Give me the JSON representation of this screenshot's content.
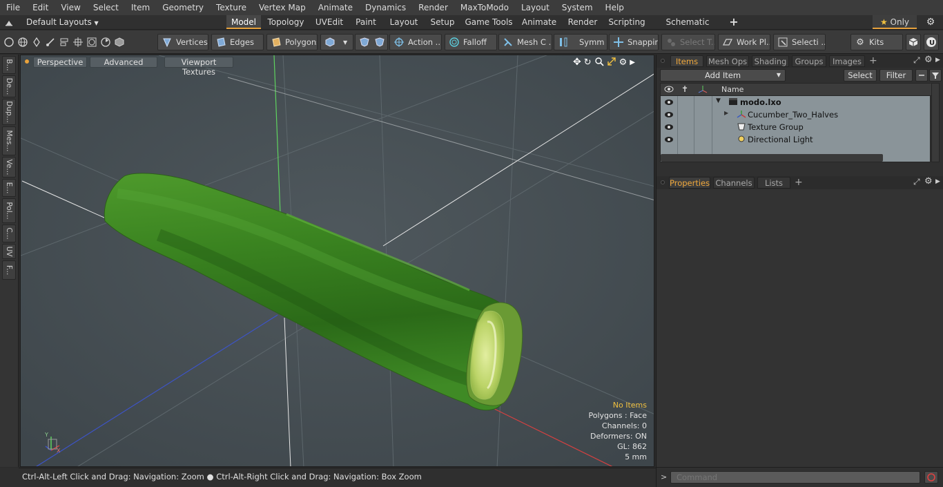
{
  "menu": [
    "File",
    "Edit",
    "View",
    "Select",
    "Item",
    "Geometry",
    "Texture",
    "Vertex Map",
    "Animate",
    "Dynamics",
    "Render",
    "MaxToModo",
    "Layout",
    "System",
    "Help"
  ],
  "layout_bar": {
    "layout_selector": "Default Layouts",
    "tabs": [
      "Model",
      "Topology",
      "UVEdit",
      "Paint",
      "Layout",
      "Setup",
      "Game Tools",
      "Animate",
      "Render",
      "Scripting",
      "Schematic Fusion"
    ],
    "active_tab": "Model",
    "add_label": "+",
    "only_label": "Only"
  },
  "toolbar": {
    "vertices": "Vertices",
    "edges": "Edges",
    "polygons": "Polygons",
    "action": "Action ...",
    "falloff": "Falloff",
    "mesh_c": "Mesh C ...",
    "symm": "Symm ...",
    "snapping": "Snapping",
    "select_t": "Select T...",
    "work_pl": "Work Pl...",
    "selecti": "Selecti ...",
    "kits": "Kits"
  },
  "left_tabs": [
    "B...",
    "De...",
    "Dup...",
    "Mes...",
    "Ve...",
    "E...",
    "Pol...",
    "C...",
    "UV",
    "F..."
  ],
  "viewport": {
    "tabs": [
      "Perspective",
      "Advanced",
      "Viewport Textures"
    ],
    "info": {
      "items": "No Items",
      "polygons": "Polygons : Face",
      "channels": "Channels: 0",
      "deformers": "Deformers: ON",
      "gl": "GL: 862",
      "scale": "5 mm"
    },
    "axis_labels": {
      "y": "Y",
      "x": "X"
    }
  },
  "status": "Ctrl-Alt-Left Click and Drag: Navigation: Zoom ● Ctrl-Alt-Right Click and Drag: Navigation: Box Zoom",
  "items_panel": {
    "tabs": [
      "Items",
      "Mesh Ops",
      "Shading",
      "Groups",
      "Images"
    ],
    "active_tab": "Items",
    "add_item": "Add Item",
    "select": "Select",
    "filter": "Filter",
    "column_name": "Name",
    "rows": [
      {
        "label": "modo.lxo",
        "bold": true
      },
      {
        "label": "Cucumber_Two_Halves",
        "bold": false
      },
      {
        "label": "Texture Group",
        "bold": false
      },
      {
        "label": "Directional Light",
        "bold": false
      }
    ]
  },
  "properties_panel": {
    "tabs": [
      "Properties",
      "Channels",
      "Lists"
    ],
    "active_tab": "Properties"
  },
  "command": {
    "prompt": ">",
    "placeholder": "Command"
  },
  "colors": {
    "accent": "#e8a23c",
    "viewport_bg": "#485055",
    "cucumber_dark": "#1f5a14",
    "cucumber_mid": "#3f8a25",
    "cucumber_flesh": "#c9df7a"
  }
}
